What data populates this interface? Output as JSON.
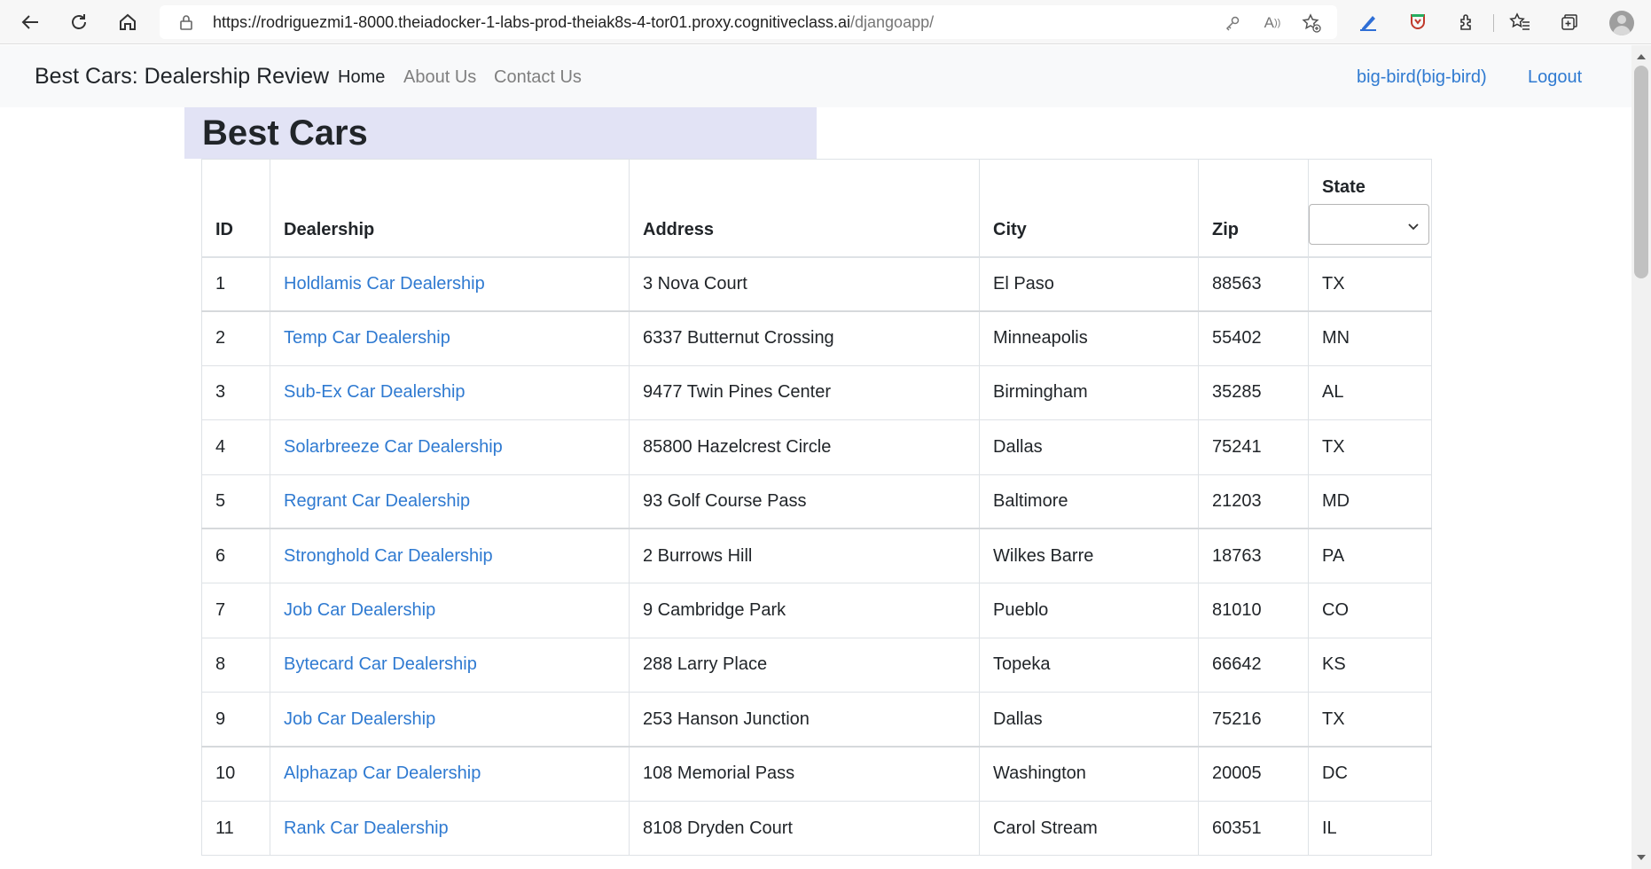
{
  "browser": {
    "url_prefix": "https://rodriguezmi1-8000.theiadocker-1-labs-prod-theiak8s-4-tor01.proxy.cognitiveclass.ai",
    "url_path": "/djangoapp/"
  },
  "navbar": {
    "brand": "Best Cars: Dealership Review",
    "links": [
      "Home",
      "About Us",
      "Contact Us"
    ],
    "user": "big-bird(big-bird)",
    "logout": "Logout"
  },
  "page": {
    "title": "Best Cars"
  },
  "table": {
    "headers": {
      "id": "ID",
      "dealership": "Dealership",
      "address": "Address",
      "city": "City",
      "zip": "Zip",
      "state": "State"
    },
    "state_filter_value": "",
    "rows": [
      {
        "id": "1",
        "dealership": "Holdlamis Car Dealership",
        "address": "3 Nova Court",
        "city": "El Paso",
        "zip": "88563",
        "state": "TX"
      },
      {
        "id": "2",
        "dealership": "Temp Car Dealership",
        "address": "6337 Butternut Crossing",
        "city": "Minneapolis",
        "zip": "55402",
        "state": "MN"
      },
      {
        "id": "3",
        "dealership": "Sub-Ex Car Dealership",
        "address": "9477 Twin Pines Center",
        "city": "Birmingham",
        "zip": "35285",
        "state": "AL"
      },
      {
        "id": "4",
        "dealership": "Solarbreeze Car Dealership",
        "address": "85800 Hazelcrest Circle",
        "city": "Dallas",
        "zip": "75241",
        "state": "TX"
      },
      {
        "id": "5",
        "dealership": "Regrant Car Dealership",
        "address": "93 Golf Course Pass",
        "city": "Baltimore",
        "zip": "21203",
        "state": "MD"
      },
      {
        "id": "6",
        "dealership": "Stronghold Car Dealership",
        "address": "2 Burrows Hill",
        "city": "Wilkes Barre",
        "zip": "18763",
        "state": "PA"
      },
      {
        "id": "7",
        "dealership": "Job Car Dealership",
        "address": "9 Cambridge Park",
        "city": "Pueblo",
        "zip": "81010",
        "state": "CO"
      },
      {
        "id": "8",
        "dealership": "Bytecard Car Dealership",
        "address": "288 Larry Place",
        "city": "Topeka",
        "zip": "66642",
        "state": "KS"
      },
      {
        "id": "9",
        "dealership": "Job Car Dealership",
        "address": "253 Hanson Junction",
        "city": "Dallas",
        "zip": "75216",
        "state": "TX"
      },
      {
        "id": "10",
        "dealership": "Alphazap Car Dealership",
        "address": "108 Memorial Pass",
        "city": "Washington",
        "zip": "20005",
        "state": "DC"
      },
      {
        "id": "11",
        "dealership": "Rank Car Dealership",
        "address": "8108 Dryden Court",
        "city": "Carol Stream",
        "zip": "60351",
        "state": "IL"
      }
    ]
  }
}
